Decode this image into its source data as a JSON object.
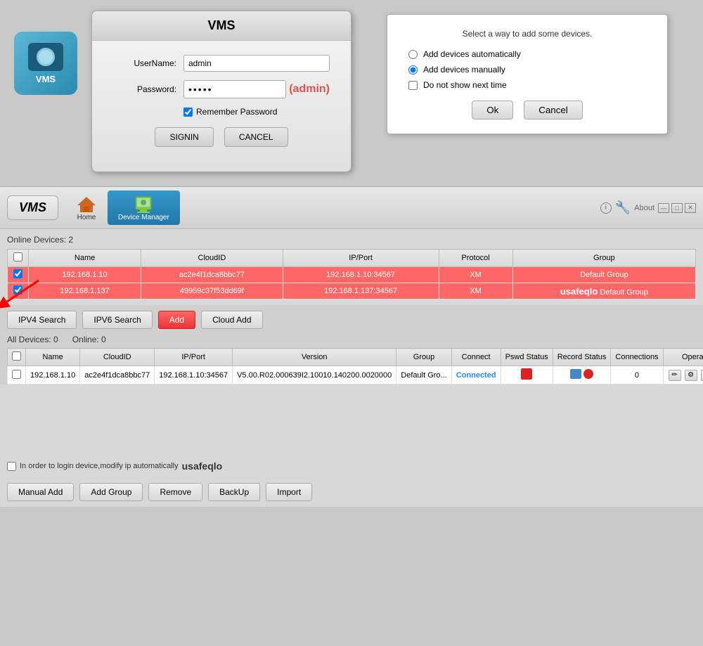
{
  "login_dialog": {
    "title": "VMS",
    "username_label": "UserName:",
    "username_value": "admin",
    "password_label": "Password:",
    "password_dots": "•••••",
    "password_hint": "(admin)",
    "remember_label": "Remember Password",
    "remember_checked": true,
    "signin_btn": "SIGNIN",
    "cancel_btn": "CANCEL"
  },
  "add_device_dialog": {
    "title": "Select a way to add some devices.",
    "option_auto": "Add devices automatically",
    "option_manual": "Add devices manually",
    "checkbox_label": "Do not show next time",
    "ok_btn": "Ok",
    "cancel_btn": "Cancel"
  },
  "nav": {
    "vms_logo": "VMS",
    "home_label": "Home",
    "device_manager_label": "Device Manager",
    "about_label": "About",
    "info_icon": "i"
  },
  "online_devices": {
    "header": "Online Devices:  2",
    "columns": [
      "",
      "Name",
      "CloudID",
      "IP/Port",
      "Protocol",
      "Group"
    ],
    "rows": [
      {
        "selected": true,
        "name": "192.168.1.10",
        "cloudid": "ac2e4f1dca8bbc77",
        "ipport": "192.168.1.10:34567",
        "protocol": "XM",
        "group": "Default Group"
      },
      {
        "selected": true,
        "name": "192.168.1.137",
        "cloudid": "49959c37f53dd69f",
        "ipport": "192.168.1.137:34567",
        "protocol": "XM",
        "group": "usafeqlo Default Group"
      }
    ]
  },
  "toolbar": {
    "ipv4_btn": "IPV4 Search",
    "ipv6_btn": "IPV6 Search",
    "add_btn": "Add",
    "cloud_add_btn": "Cloud Add"
  },
  "all_devices": {
    "header_all": "All Devices:  0",
    "header_online": "Online:  0",
    "columns": [
      "",
      "Name",
      "CloudID",
      "IP/Port",
      "Version",
      "Group",
      "Connect",
      "Pswd Status",
      "Record Status",
      "Connections",
      "Operation"
    ],
    "rows": [
      {
        "name": "192.168.1.10",
        "cloudid": "ac2e4f1dca8bbc77",
        "ipport": "192.168.1.10:34567",
        "version": "V5.00.R02.000639I2.10010.140200.0020000",
        "group": "Default Gro...",
        "connect": "Connected",
        "connections": "0"
      }
    ]
  },
  "footer": {
    "checkbox_label": "In order to login device,modify ip automatically",
    "brand_text": "usafeqlo",
    "manual_add_btn": "Manual Add",
    "add_group_btn": "Add Group",
    "remove_btn": "Remove",
    "backup_btn": "BackUp",
    "import_btn": "Import"
  },
  "vms_icon": {
    "label": "VMS"
  }
}
